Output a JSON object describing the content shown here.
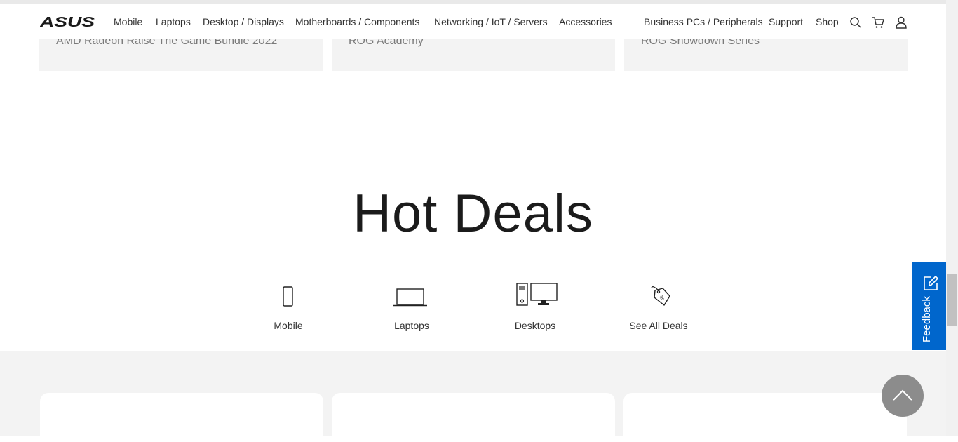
{
  "header": {
    "logo_text": "ASUS",
    "nav": [
      "Mobile",
      "Laptops",
      "Desktop / Displays",
      "Motherboards / Components",
      "Networking / IoT / Servers",
      "Accessories",
      "Business PCs / Peripherals",
      "Support",
      "Shop"
    ],
    "icons": [
      "search-icon",
      "cart-icon",
      "user-icon"
    ]
  },
  "promos": [
    "AMD Radeon Raise The Game Bundle 2022",
    "ROG Academy",
    "ROG Showdown Series"
  ],
  "hot_deals": {
    "title": "Hot Deals",
    "categories": [
      {
        "label": "Mobile",
        "icon": "phone-icon"
      },
      {
        "label": "Laptops",
        "icon": "laptop-icon"
      },
      {
        "label": "Desktops",
        "icon": "desktop-icon"
      },
      {
        "label": "See All Deals",
        "icon": "tag-icon"
      }
    ]
  },
  "feedback": {
    "label": "Feedback",
    "color": "#0066cc"
  },
  "back_to_top": {
    "icon": "chevron-up-icon"
  }
}
